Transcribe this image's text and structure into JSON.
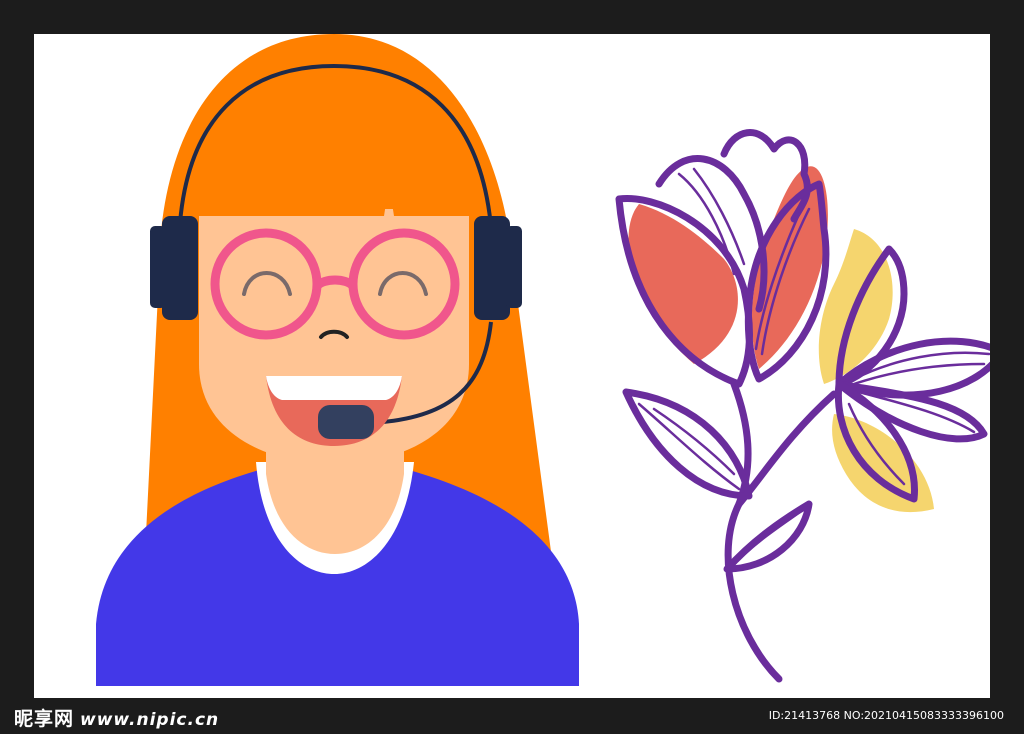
{
  "watermark": {
    "brand": "昵享网",
    "url": "www.nipic.cn",
    "id_text": "ID:21413768 NO:20210415083333396100"
  },
  "colors": {
    "frame": "#1c1c1c",
    "background": "#ffffff",
    "hair": "#ff8000",
    "skin": "#ffc494",
    "shirt": "#4338e8",
    "glasses": "#f0568c",
    "headset": "#1e2a4a",
    "flower_outline": "#6a2d9c",
    "petal_red": "#e8695a",
    "petal_yellow": "#f5d56e"
  },
  "icons": [
    "headset-icon",
    "flower-icon"
  ]
}
